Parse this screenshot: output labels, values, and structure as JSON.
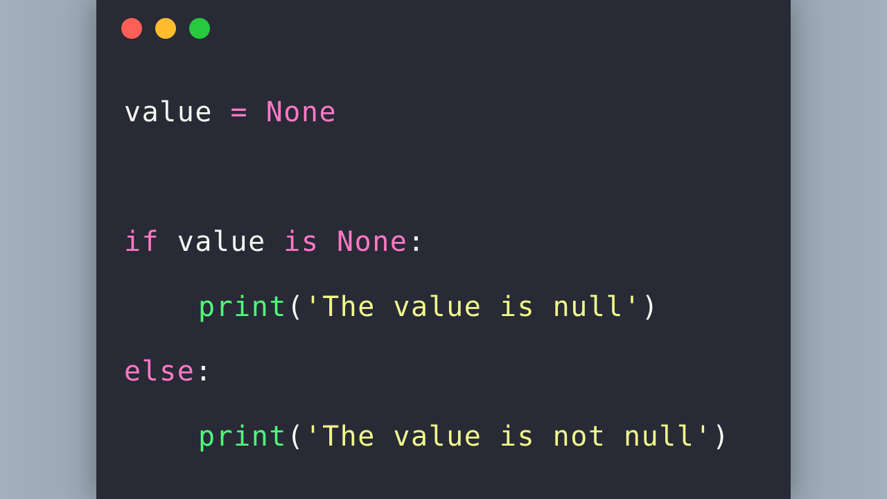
{
  "window": {
    "traffic_lights": [
      {
        "name": "close",
        "color": "#ff5f56"
      },
      {
        "name": "minimize",
        "color": "#ffbd2e"
      },
      {
        "name": "maximize",
        "color": "#27c93f"
      }
    ]
  },
  "code": {
    "line1": {
      "ident": "value",
      "op": "=",
      "const": "None"
    },
    "line2": {
      "kw_if": "if",
      "ident": "value",
      "kw_is": "is",
      "const": "None",
      "colon": ":"
    },
    "line3": {
      "fn": "print",
      "open": "(",
      "str": "'The value is null'",
      "close": ")"
    },
    "line4": {
      "kw_else": "else",
      "colon": ":"
    },
    "line5": {
      "fn": "print",
      "open": "(",
      "str": "'The value is not null'",
      "close": ")"
    }
  },
  "colors": {
    "background": "#282a36",
    "keyword": "#ff79c6",
    "function": "#50fa7b",
    "string": "#f1fa8c",
    "text": "#f8f8f2"
  }
}
